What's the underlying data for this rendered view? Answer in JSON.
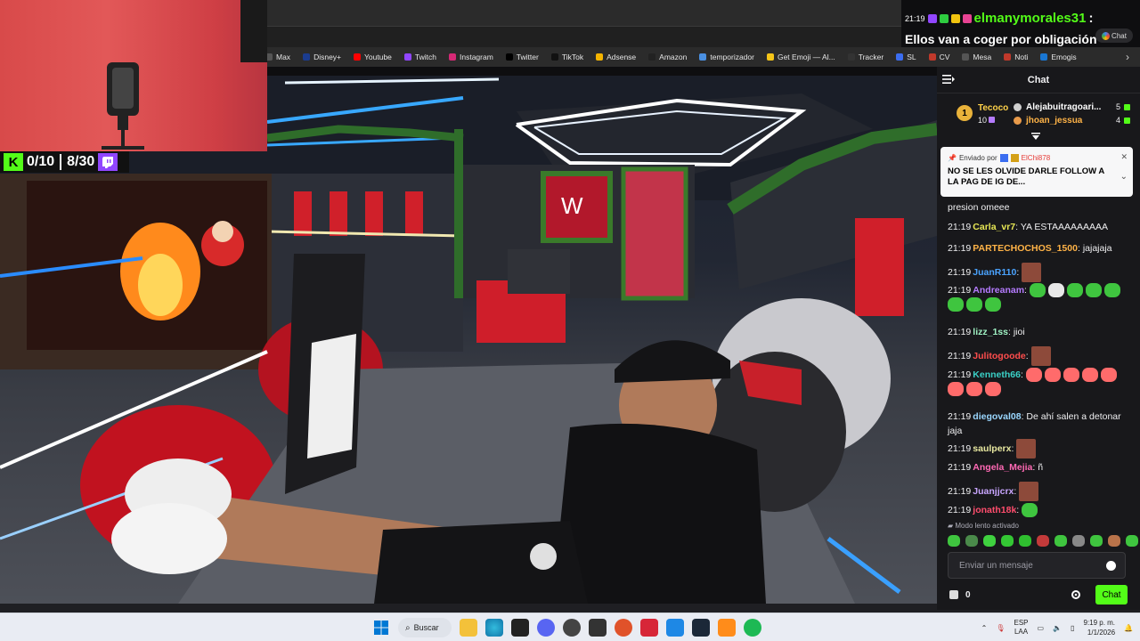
{
  "bookmarks": [
    {
      "label": "Max",
      "color": "#555"
    },
    {
      "label": "Disney+",
      "color": "#1b3c8f"
    },
    {
      "label": "Youtube",
      "color": "#ff0000"
    },
    {
      "label": "Twitch",
      "color": "#9146ff"
    },
    {
      "label": "Instagram",
      "color": "#d62976"
    },
    {
      "label": "Twitter",
      "color": "#000"
    },
    {
      "label": "TikTok",
      "color": "#111"
    },
    {
      "label": "Adsense",
      "color": "#f4b400"
    },
    {
      "label": "Amazon",
      "color": "#222"
    },
    {
      "label": "temporizador",
      "color": "#4a90e2"
    },
    {
      "label": "Get Emoji — Al...",
      "color": "#f5c518"
    },
    {
      "label": "Tracker",
      "color": "#333"
    },
    {
      "label": "SL",
      "color": "#3b6df0"
    },
    {
      "label": "CV",
      "color": "#c0392b"
    },
    {
      "label": "Mesa",
      "color": "#555"
    },
    {
      "label": "Noti",
      "color": "#c0392b"
    },
    {
      "label": "Emogis",
      "color": "#1976d2"
    }
  ],
  "counter": {
    "k_label": "K",
    "kick_count": "0/10",
    "twitch_count": "8/30"
  },
  "top_message": {
    "time": "21:19",
    "user": "elmanymorales31",
    "colon": ":",
    "text": "Ellos van a coger por obligación",
    "chat_pill": "Chat"
  },
  "chat": {
    "title": "Chat",
    "leaderboard": {
      "rank": "1",
      "top_name": "Tecoco",
      "top_count": "10",
      "second_name": "Alejabuitragoari...",
      "second_count": "5",
      "third_name": "jhoan_jessua",
      "third_count": "4"
    },
    "pinned": {
      "by_label": "Enviado por",
      "by_user": "ElChi878",
      "text": "NO SE LES OLVIDE DARLE FOLLOW A LA PAG DE IG DE..."
    },
    "partial_message": "presion omeee",
    "messages": [
      {
        "time": "21:19",
        "user": "Carla_vr7",
        "color": "#e8e855",
        "text": "YA ESTAAAAAAAAA"
      },
      {
        "time": "21:19",
        "user": "PARTECHOCHOS_1500",
        "color": "#ffb347",
        "text": "jajajaja"
      },
      {
        "time": "21:19",
        "user": "JuanR110",
        "color": "#4aa3ff",
        "text": ""
      },
      {
        "time": "21:19",
        "user": "Andreanam",
        "color": "#b57bff",
        "text": ""
      },
      {
        "time": "21:19",
        "user": "lizz_1ss",
        "color": "#9ef0c2",
        "text": "jioi"
      },
      {
        "time": "21:19",
        "user": "Julitogoode",
        "color": "#ff4d4d",
        "text": ""
      },
      {
        "time": "21:19",
        "user": "Kenneth66",
        "color": "#3ad1c7",
        "text": ""
      },
      {
        "time": "21:19",
        "user": "diegoval08",
        "color": "#9ad7ff",
        "text": "De ahí salen a detonar jaja"
      },
      {
        "time": "21:19",
        "user": "saulperx",
        "color": "#e8e8a0",
        "text": ""
      },
      {
        "time": "21:19",
        "user": "Angela_Mejia",
        "color": "#ff69b4",
        "text": "ñ"
      },
      {
        "time": "21:19",
        "user": "Juanjjcrx",
        "color": "#c9a6ff",
        "text": ""
      },
      {
        "time": "21:19",
        "user": "jonath18k",
        "color": "#ff4d6d",
        "text": ""
      }
    ],
    "slow_mode": "Modo lento activado",
    "input_placeholder": "Enviar un mensaje",
    "points": "0",
    "send_label": "Chat"
  },
  "taskbar": {
    "search_label": "Buscar",
    "lang_top": "ESP",
    "lang_bottom": "LAA",
    "time": "9:19 p. m.",
    "date": "1/1/2026"
  }
}
